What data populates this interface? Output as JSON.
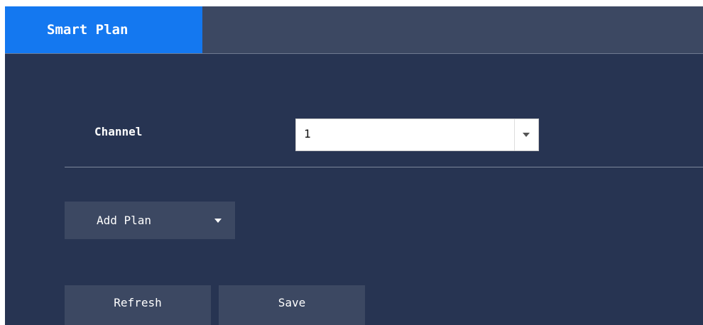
{
  "tabs": {
    "active_label": "Smart Plan"
  },
  "channel": {
    "label": "Channel",
    "selected_value": "1"
  },
  "add_plan": {
    "label": "Add Plan"
  },
  "buttons": {
    "refresh_label": "Refresh",
    "save_label": "Save"
  },
  "colors": {
    "background": "#273452",
    "tab_bar": "#3c4862",
    "active_tab": "#1478f0",
    "button": "#3c4862"
  },
  "icons": {
    "channel_dropdown": "chevron-down-icon",
    "add_plan_dropdown": "chevron-down-icon"
  }
}
